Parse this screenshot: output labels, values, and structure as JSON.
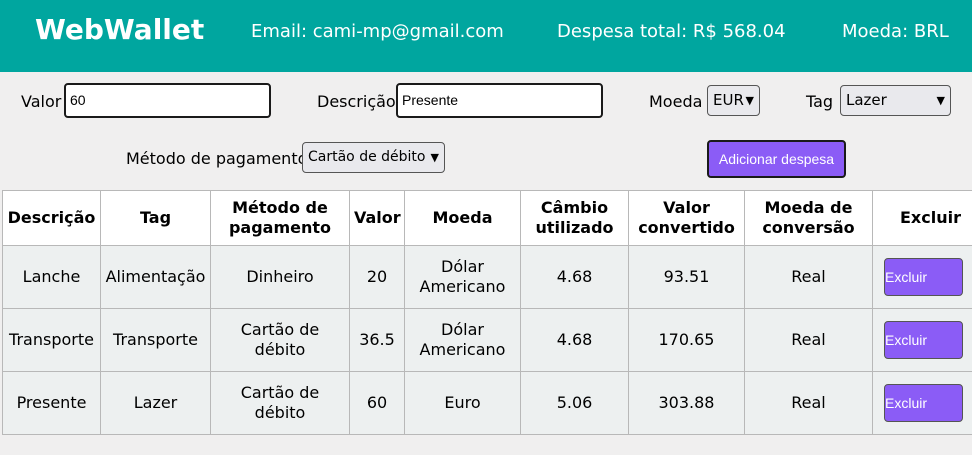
{
  "header": {
    "logo": "WebWallet",
    "email": "Email: cami-mp@gmail.com",
    "total": "Despesa total: R$ 568.04",
    "currency": "Moeda: BRL"
  },
  "form": {
    "valor_label": "Valor",
    "valor_value": "60",
    "descricao_label": "Descrição",
    "descricao_value": "Presente",
    "moeda_label": "Moeda",
    "moeda_selected": "EUR",
    "tag_label": "Tag",
    "tag_selected": "Lazer",
    "metodo_label": "Método de pagamento",
    "metodo_selected": "Cartão de débito",
    "add_button": "Adicionar despesa"
  },
  "table": {
    "headers": [
      "Descrição",
      "Tag",
      "Método de pagamento",
      "Valor",
      "Moeda",
      "Câmbio utilizado",
      "Valor convertido",
      "Moeda de conversão",
      "Excluir"
    ],
    "rows": [
      [
        "Lanche",
        "Alimentação",
        "Dinheiro",
        "20",
        "Dólar Americano",
        "4.68",
        "93.51",
        "Real",
        "Excluir"
      ],
      [
        "Transporte",
        "Transporte",
        "Cartão de débito",
        "36.5",
        "Dólar Americano",
        "4.68",
        "170.65",
        "Real",
        "Excluir"
      ],
      [
        "Presente",
        "Lazer",
        "Cartão de débito",
        "60",
        "Euro",
        "5.06",
        "303.88",
        "Real",
        "Excluir"
      ]
    ]
  },
  "colors": {
    "header_bg": "#00a69f",
    "button_bg": "#8b5cf6"
  }
}
